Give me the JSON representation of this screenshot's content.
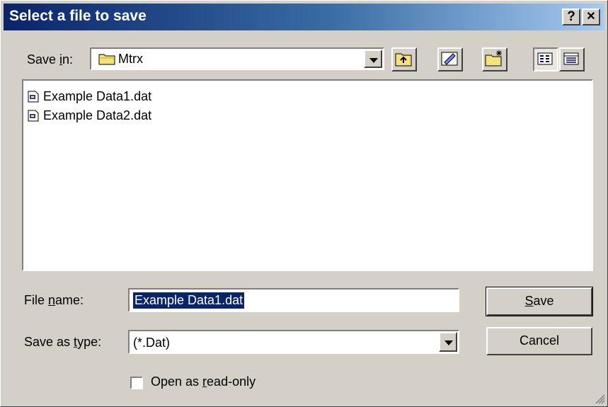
{
  "titlebar": {
    "title": "Select a file to save",
    "help_label": "?",
    "close_label": "✕"
  },
  "toolbar": {
    "save_in_label": "Save in:",
    "save_in_value": "Mtrx",
    "up_icon": "up-folder-icon",
    "desktop_icon": "desktop-icon",
    "new_folder_icon": "new-folder-icon",
    "list_view_icon": "list-view-icon",
    "details_view_icon": "details-view-icon"
  },
  "files": [
    {
      "name": "Example Data1.dat",
      "icon": "dat-file-icon"
    },
    {
      "name": "Example Data2.dat",
      "icon": "dat-file-icon"
    }
  ],
  "form": {
    "file_name_label": "File name:",
    "file_name_value": "Example Data1.dat",
    "save_type_label": "Save as type:",
    "save_type_value": "(*.Dat)",
    "readonly_label": "Open as read-only",
    "readonly_checked": false
  },
  "buttons": {
    "save": "Save",
    "cancel": "Cancel"
  },
  "colors": {
    "title_start": "#0a246a",
    "title_end": "#a6caf0",
    "face": "#d4d0c8",
    "selection": "#0a246a"
  }
}
